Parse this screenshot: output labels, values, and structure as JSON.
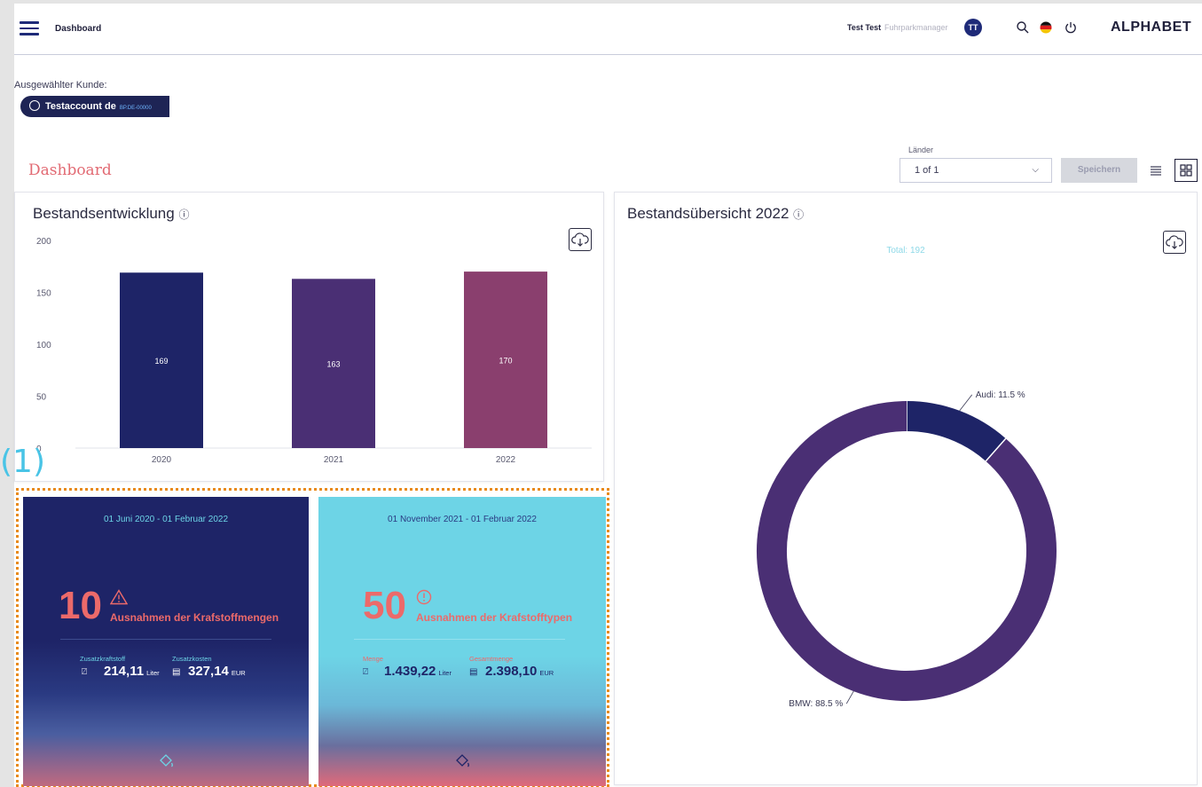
{
  "header": {
    "breadcrumb": "Dashboard",
    "user_name": "Test Test",
    "user_role": "Fuhrparkmanager",
    "avatar_initials": "TT",
    "brand": "ALPHABET"
  },
  "customer": {
    "label": "Ausgewählter Kunde:",
    "name": "Testaccount de",
    "id": "BP.DE-00000"
  },
  "page_title": "Dashboard",
  "filters": {
    "countries_label": "Länder",
    "countries_value": "1 of 1",
    "save_label": "Speichern"
  },
  "bar_card": {
    "title": "Bestandsentwicklung",
    "info_icon": "info-icon"
  },
  "donut_card": {
    "title": "Bestandsübersicht 2022",
    "total": "Total: 192"
  },
  "colors": {
    "navy": "#1e2467",
    "purple": "#4a2f74",
    "plum": "#8a3f6e",
    "cyan": "#6dd4e6",
    "coral": "#ec6a6a"
  },
  "chart_data": [
    {
      "type": "bar",
      "categories": [
        "2020",
        "2021",
        "2022"
      ],
      "values": [
        169,
        163,
        170
      ],
      "data_labels": [
        "169",
        "163",
        "170"
      ],
      "ylim": [
        0,
        200
      ],
      "yticks": [
        "0",
        "50",
        "100",
        "150",
        "200"
      ],
      "grid": false,
      "legend": "none"
    },
    {
      "type": "pie",
      "donut": true,
      "categories": [
        "Audi",
        "BMW"
      ],
      "values": [
        11.5,
        88.5
      ],
      "labels": [
        "Audi: 11.5 %",
        "BMW: 88.5 %"
      ],
      "legend": "none"
    }
  ],
  "callout": "(1)",
  "tiles": [
    {
      "date_range": "01 Juni 2020 - 01 Februar 2022",
      "count": "10",
      "icon": "warning-triangle-icon",
      "label": "Ausnahmen der Krafstoffmengen",
      "stat1_label": "Zusatzkraftstoff",
      "stat1_value": "214,11",
      "stat1_unit": "Liter",
      "stat2_label": "Zusatzkosten",
      "stat2_value": "327,14",
      "stat2_unit": "EUR"
    },
    {
      "date_range": "01 November 2021 - 01 Februar 2022",
      "count": "50",
      "icon": "alert-circle-icon",
      "label": "Ausnahmen der Krafstofftypen",
      "stat1_label": "Menge",
      "stat1_value": "1.439,22",
      "stat1_unit": "Liter",
      "stat2_label": "Gesamtmenge",
      "stat2_value": "2.398,10",
      "stat2_unit": "EUR"
    }
  ]
}
